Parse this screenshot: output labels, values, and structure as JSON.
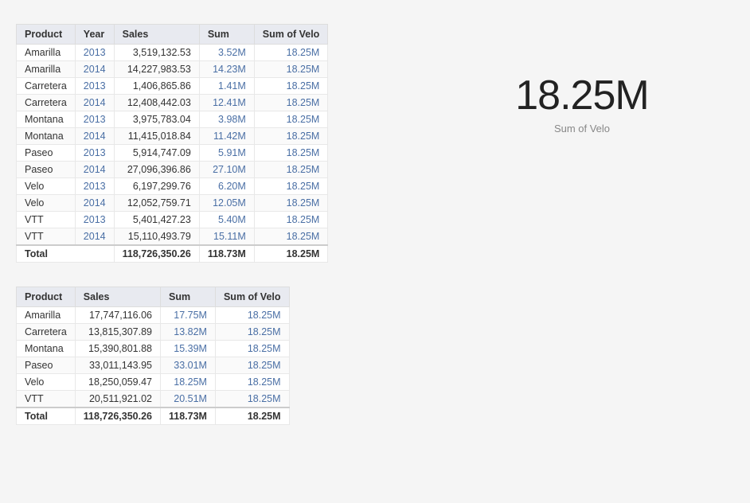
{
  "table1": {
    "headers": [
      "Product",
      "Year",
      "Sales",
      "Sum",
      "Sum of Velo"
    ],
    "rows": [
      {
        "product": "Amarilla",
        "year": "2013",
        "sales": "3,519,132.53",
        "sum": "3.52M",
        "sumvelo": "18.25M"
      },
      {
        "product": "Amarilla",
        "year": "2014",
        "sales": "14,227,983.53",
        "sum": "14.23M",
        "sumvelo": "18.25M"
      },
      {
        "product": "Carretera",
        "year": "2013",
        "sales": "1,406,865.86",
        "sum": "1.41M",
        "sumvelo": "18.25M"
      },
      {
        "product": "Carretera",
        "year": "2014",
        "sales": "12,408,442.03",
        "sum": "12.41M",
        "sumvelo": "18.25M"
      },
      {
        "product": "Montana",
        "year": "2013",
        "sales": "3,975,783.04",
        "sum": "3.98M",
        "sumvelo": "18.25M"
      },
      {
        "product": "Montana",
        "year": "2014",
        "sales": "11,415,018.84",
        "sum": "11.42M",
        "sumvelo": "18.25M"
      },
      {
        "product": "Paseo",
        "year": "2013",
        "sales": "5,914,747.09",
        "sum": "5.91M",
        "sumvelo": "18.25M"
      },
      {
        "product": "Paseo",
        "year": "2014",
        "sales": "27,096,396.86",
        "sum": "27.10M",
        "sumvelo": "18.25M"
      },
      {
        "product": "Velo",
        "year": "2013",
        "sales": "6,197,299.76",
        "sum": "6.20M",
        "sumvelo": "18.25M"
      },
      {
        "product": "Velo",
        "year": "2014",
        "sales": "12,052,759.71",
        "sum": "12.05M",
        "sumvelo": "18.25M"
      },
      {
        "product": "VTT",
        "year": "2013",
        "sales": "5,401,427.23",
        "sum": "5.40M",
        "sumvelo": "18.25M"
      },
      {
        "product": "VTT",
        "year": "2014",
        "sales": "15,110,493.79",
        "sum": "15.11M",
        "sumvelo": "18.25M"
      }
    ],
    "total": {
      "label": "Total",
      "sales": "118,726,350.26",
      "sum": "118.73M",
      "sumvelo": "18.25M"
    }
  },
  "table2": {
    "headers": [
      "Product",
      "Sales",
      "Sum",
      "Sum of Velo"
    ],
    "rows": [
      {
        "product": "Amarilla",
        "sales": "17,747,116.06",
        "sum": "17.75M",
        "sumvelo": "18.25M"
      },
      {
        "product": "Carretera",
        "sales": "13,815,307.89",
        "sum": "13.82M",
        "sumvelo": "18.25M"
      },
      {
        "product": "Montana",
        "sales": "15,390,801.88",
        "sum": "15.39M",
        "sumvelo": "18.25M"
      },
      {
        "product": "Paseo",
        "sales": "33,011,143.95",
        "sum": "33.01M",
        "sumvelo": "18.25M"
      },
      {
        "product": "Velo",
        "sales": "18,250,059.47",
        "sum": "18.25M",
        "sumvelo": "18.25M"
      },
      {
        "product": "VTT",
        "sales": "20,511,921.02",
        "sum": "20.51M",
        "sumvelo": "18.25M"
      }
    ],
    "total": {
      "label": "Total",
      "sales": "118,726,350.26",
      "sum": "118.73M",
      "sumvelo": "18.25M"
    }
  },
  "kpi": {
    "value": "18.25M",
    "label": "Sum of Velo"
  }
}
